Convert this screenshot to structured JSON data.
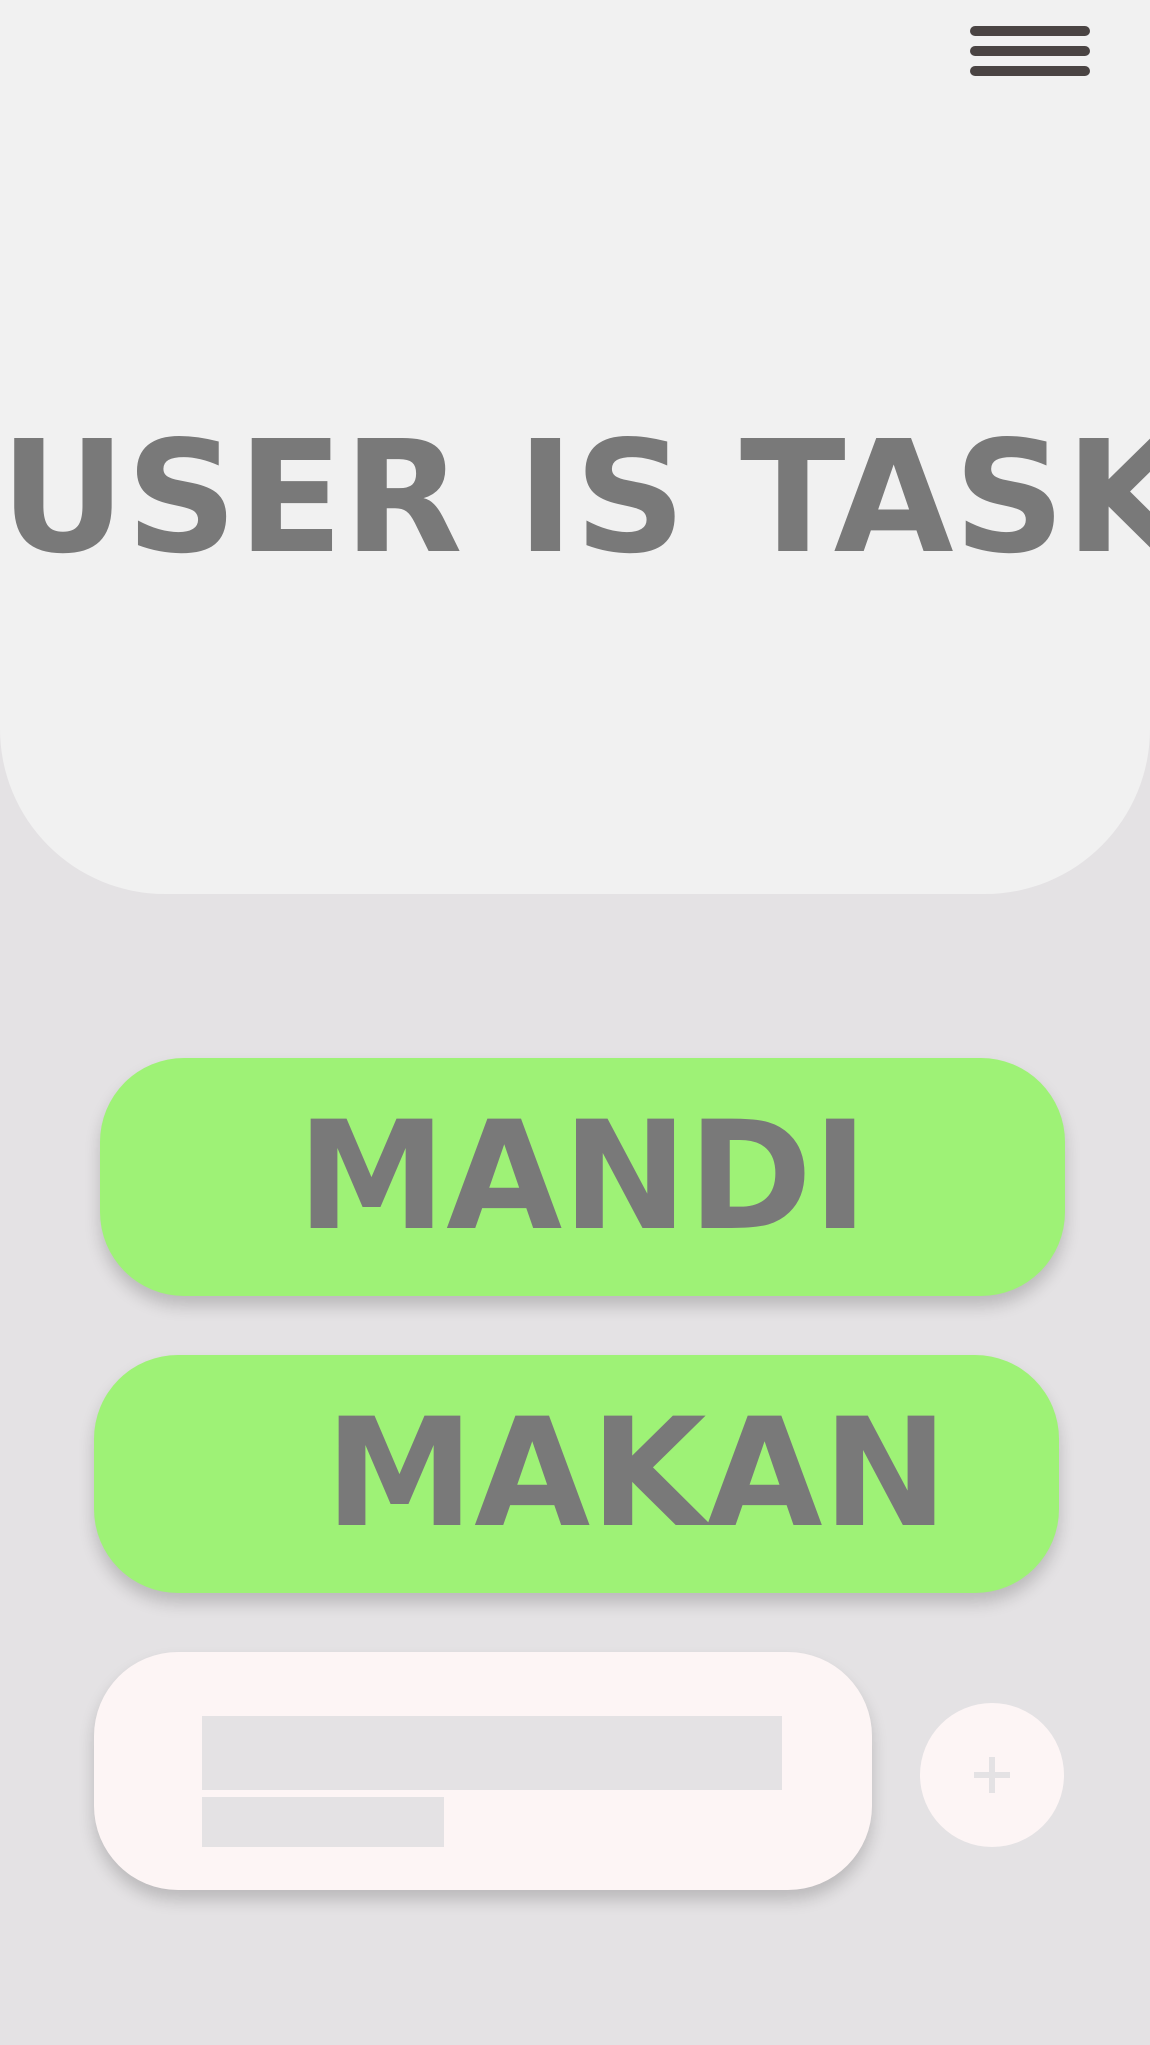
{
  "header": {
    "title": "USER IS TASK",
    "menu_icon": "hamburger-menu-icon"
  },
  "tasks": [
    {
      "label": "MANDI"
    },
    {
      "label": "MAKAN"
    }
  ],
  "new_task": {
    "title_value": "",
    "detail_value": "",
    "add_icon": "plus-icon"
  },
  "colors": {
    "background": "#e4e2e4",
    "header": "#f1f1f1",
    "task_card": "#9ef276",
    "text": "#797979",
    "input_card": "#fdf5f5",
    "menu_bars": "#4a4443"
  }
}
